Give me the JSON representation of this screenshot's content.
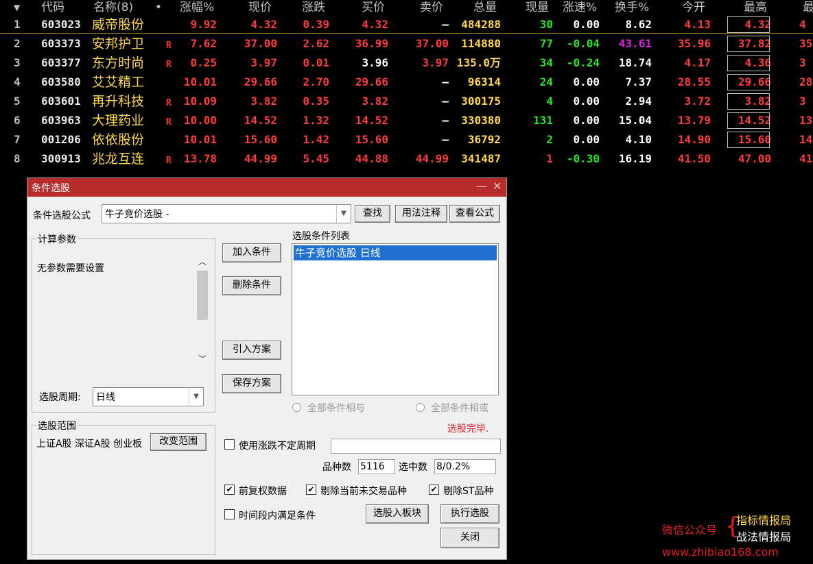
{
  "table": {
    "headers": [
      "代码",
      "名称(8)",
      "涨幅%",
      "现价",
      "涨跌",
      "买价",
      "卖价",
      "总量",
      "现量",
      "涨速%",
      "换手%",
      "今开",
      "最高",
      "最"
    ],
    "rows": [
      {
        "no": "1",
        "code": "603023",
        "name": "威帝股份",
        "r": "",
        "chg_pct": "9.92",
        "price": "4.32",
        "chg": "0.39",
        "bid": "4.32",
        "ask": "—",
        "vol": "484288",
        "cur": "30",
        "speed": "0.00",
        "turn": "8.62",
        "open": "4.13",
        "high": "4.32",
        "last": "4"
      },
      {
        "no": "2",
        "code": "603373",
        "name": "安邦护卫",
        "r": "R",
        "chg_pct": "7.62",
        "price": "37.00",
        "chg": "2.62",
        "bid": "36.99",
        "ask": "37.00",
        "vol": "114880",
        "cur": "77",
        "speed": "-0.04",
        "turn": "43.61",
        "open": "35.96",
        "high": "37.82",
        "last": "35"
      },
      {
        "no": "3",
        "code": "603377",
        "name": "东方时尚",
        "r": "R",
        "chg_pct": "0.25",
        "price": "3.97",
        "chg": "0.01",
        "bid": "3.96",
        "ask": "3.97",
        "vol": "135.0万",
        "cur": "34",
        "speed": "-0.24",
        "turn": "18.74",
        "open": "4.17",
        "high": "4.36",
        "last": "3"
      },
      {
        "no": "4",
        "code": "603580",
        "name": "艾艾精工",
        "r": "",
        "chg_pct": "10.01",
        "price": "29.66",
        "chg": "2.70",
        "bid": "29.66",
        "ask": "—",
        "vol": "96314",
        "cur": "24",
        "speed": "0.00",
        "turn": "7.37",
        "open": "28.55",
        "high": "29.66",
        "last": "28"
      },
      {
        "no": "5",
        "code": "603601",
        "name": "再升科技",
        "r": "R",
        "chg_pct": "10.09",
        "price": "3.82",
        "chg": "0.35",
        "bid": "3.82",
        "ask": "—",
        "vol": "300175",
        "cur": "4",
        "speed": "0.00",
        "turn": "2.94",
        "open": "3.72",
        "high": "3.82",
        "last": "3"
      },
      {
        "no": "6",
        "code": "603963",
        "name": "大理药业",
        "r": "R",
        "chg_pct": "10.00",
        "price": "14.52",
        "chg": "1.32",
        "bid": "14.52",
        "ask": "—",
        "vol": "330380",
        "cur": "131",
        "speed": "0.00",
        "turn": "15.04",
        "open": "13.79",
        "high": "14.52",
        "last": "13"
      },
      {
        "no": "7",
        "code": "001206",
        "name": "依依股份",
        "r": "",
        "chg_pct": "10.01",
        "price": "15.60",
        "chg": "1.42",
        "bid": "15.60",
        "ask": "—",
        "vol": "36792",
        "cur": "2",
        "speed": "0.00",
        "turn": "4.10",
        "open": "14.90",
        "high": "15.60",
        "last": "14"
      },
      {
        "no": "8",
        "code": "300913",
        "name": "兆龙互连",
        "r": "R",
        "chg_pct": "13.78",
        "price": "44.99",
        "chg": "5.45",
        "bid": "44.88",
        "ask": "44.99",
        "vol": "341487",
        "cur": "1",
        "speed": "-0.30",
        "turn": "16.19",
        "open": "41.50",
        "high": "47.00",
        "last": "41"
      }
    ]
  },
  "dialog": {
    "title": "条件选股",
    "formula_label": "条件选股公式",
    "formula_value": "牛子竞价选股  -",
    "btn_find": "查找",
    "btn_usage": "用法注释",
    "btn_view": "查看公式",
    "params_group": "计算参数",
    "params_text": "无参数需要设置",
    "period_label": "选股周期:",
    "period_value": "日线",
    "btn_add": "加入条件",
    "btn_delete": "删除条件",
    "btn_import": "引入方案",
    "btn_save": "保存方案",
    "list_label": "选股条件列表",
    "list_items": [
      "牛子竞价选股  日线"
    ],
    "radio_and": "全部条件相与",
    "radio_or": "全部条件相或",
    "status": "选股完毕.",
    "range_group": "选股范围",
    "range_text": "上证A股 深证A股 创业板",
    "btn_change_range": "改变范围",
    "chk_variable_period": "使用涨跌不定周期",
    "count_label": "品种数",
    "count_value": "5116",
    "selected_label": "选中数",
    "selected_value": "8/0.2%",
    "chk_adjust": "前复权数据",
    "chk_exclude_untraded": "剔除当前未交易品种",
    "chk_exclude_st": "剔除ST品种",
    "chk_period_satisfy": "时间段内满足条件",
    "btn_to_block": "选股入板块",
    "btn_execute": "执行选股",
    "btn_close": "关闭"
  },
  "watermark": {
    "wechat_label": "微信公众号",
    "name1": "指标情报局",
    "name2": "战法情报局",
    "url": "www.zhibiao168.com"
  },
  "colors": {
    "up": "#ff3c3c",
    "down": "#26e626",
    "name": "#ffd84a",
    "title_bar": "#b82b2b",
    "selected": "#1e6fd0"
  }
}
